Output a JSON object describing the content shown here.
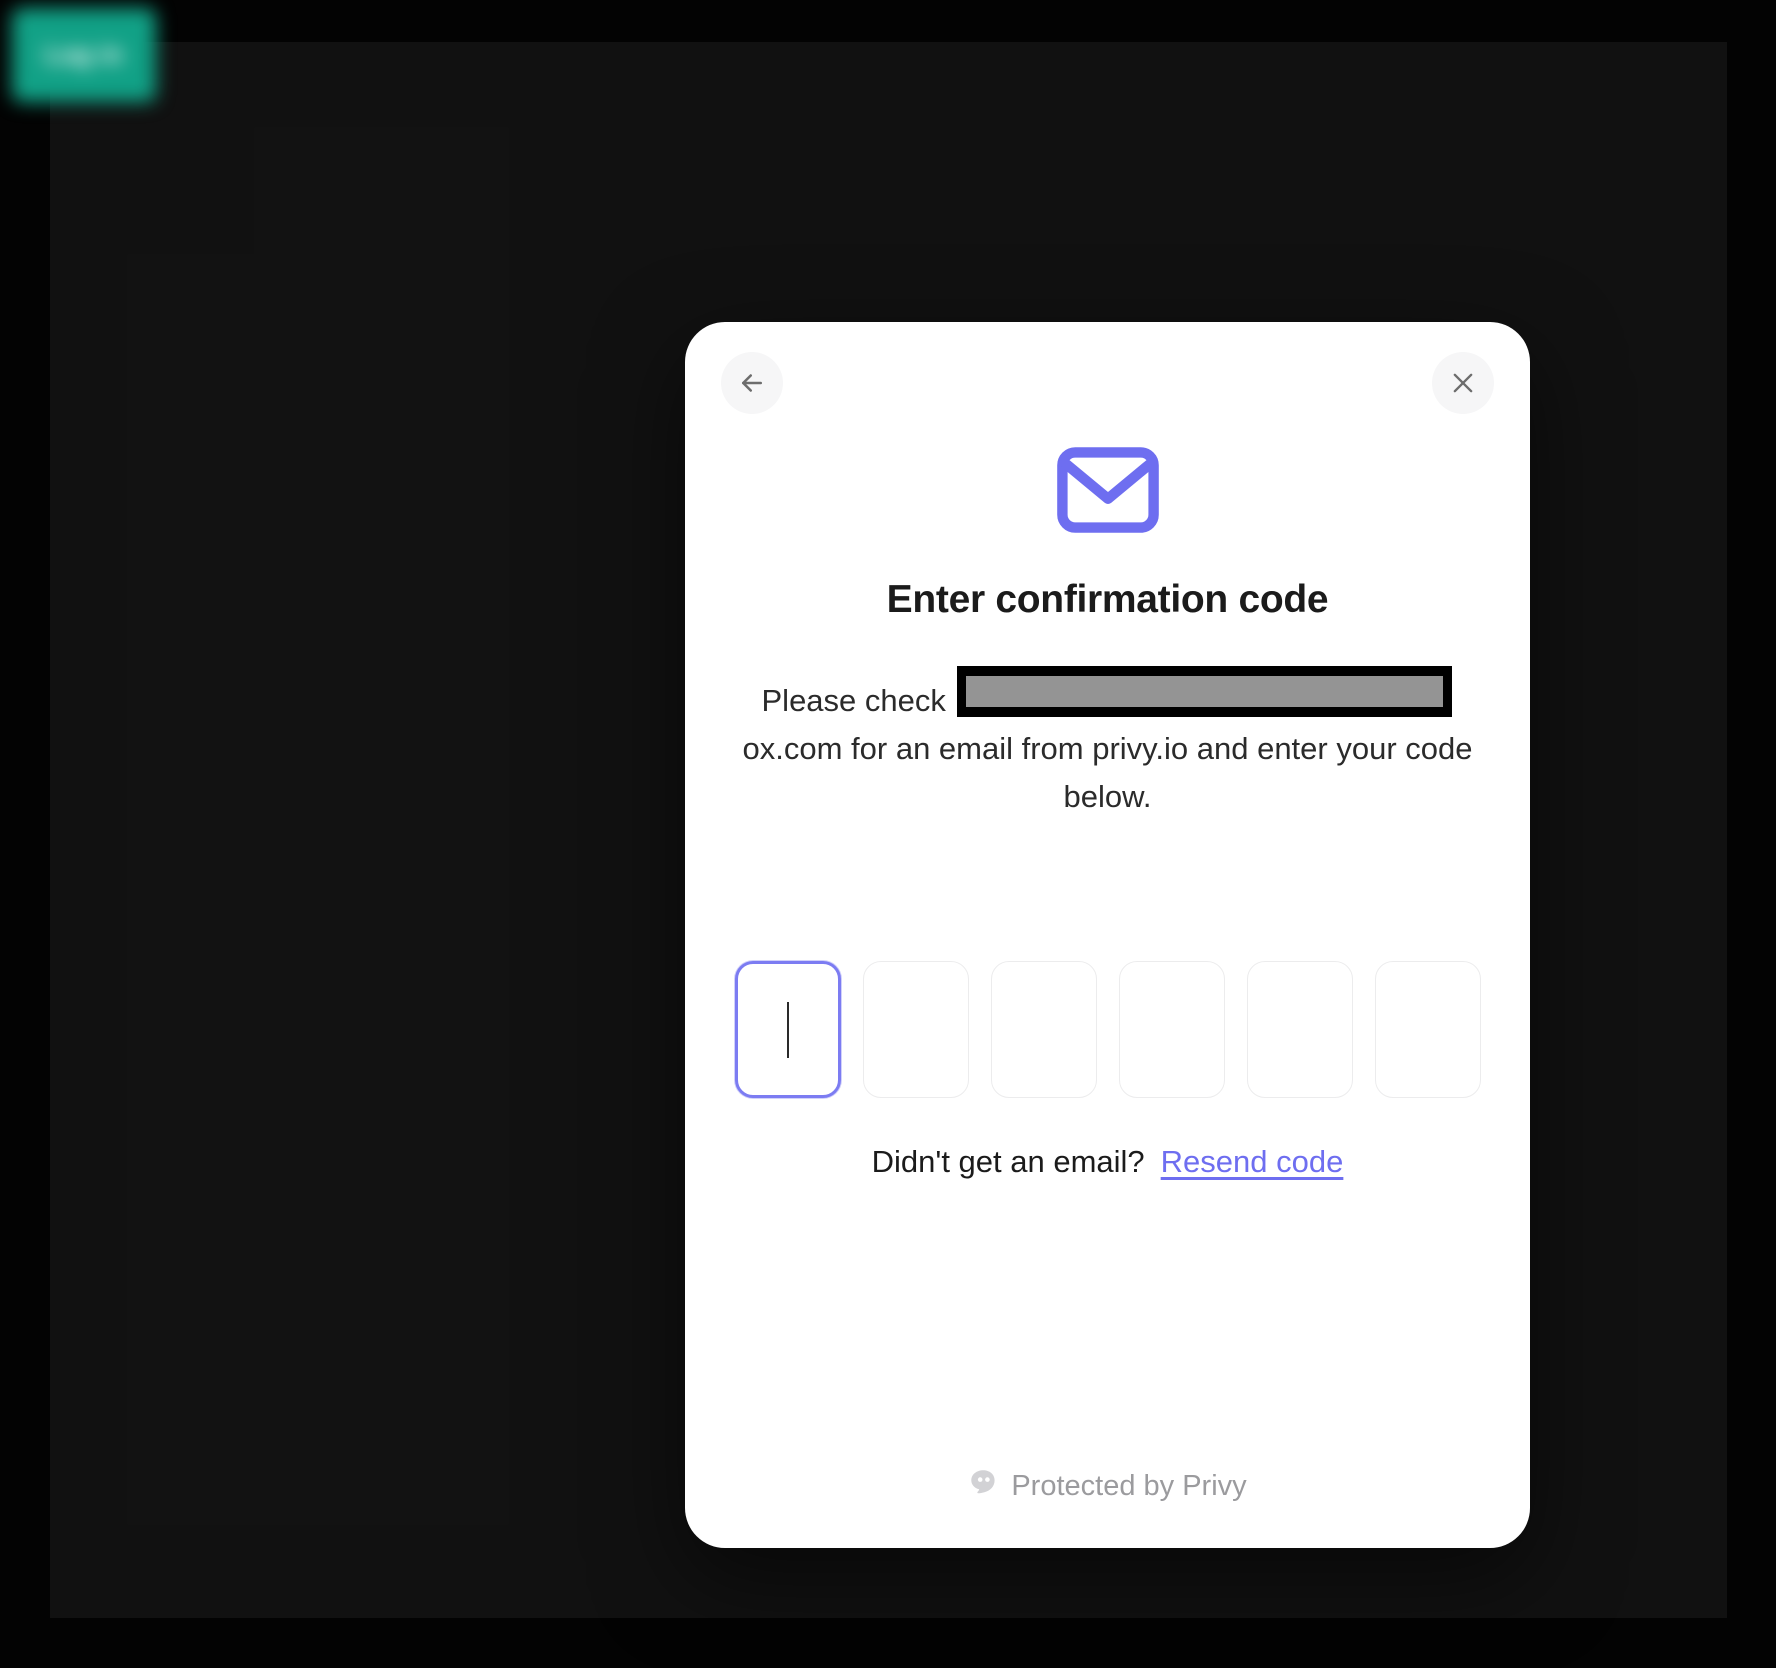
{
  "window": {
    "background_color": "#030303",
    "backdrop_color": "#1b1b1b"
  },
  "brand_badge": {
    "label": "Log in",
    "color": "#11a186",
    "blurred": true
  },
  "modal": {
    "background_color": "#ffffff",
    "accent_color": "#6e6ef0",
    "topbar": {
      "back_button": {
        "icon": "arrow-left-icon",
        "label": "Back"
      },
      "close_button": {
        "icon": "close-icon",
        "label": "Close"
      }
    },
    "hero_icon": {
      "name": "envelope-icon",
      "color": "#6e6ef0"
    },
    "title": "Enter confirmation code",
    "body": {
      "prefix": "Please check ",
      "redacted_email": "██████████████████",
      "suffix": "ox.com for an email from privy.io and enter your code below."
    },
    "otp": {
      "length": 6,
      "values": [
        "",
        "",
        "",
        "",
        "",
        ""
      ],
      "focused_index": 0,
      "caret_visible": true,
      "border_color": "#ececed",
      "focus_border_color": "#7c7cf2"
    },
    "resend": {
      "question": "Didn't get an email?",
      "link_label": "Resend code"
    },
    "footer": {
      "icon": "privy-ghost-icon",
      "label": "Protected by Privy"
    }
  }
}
